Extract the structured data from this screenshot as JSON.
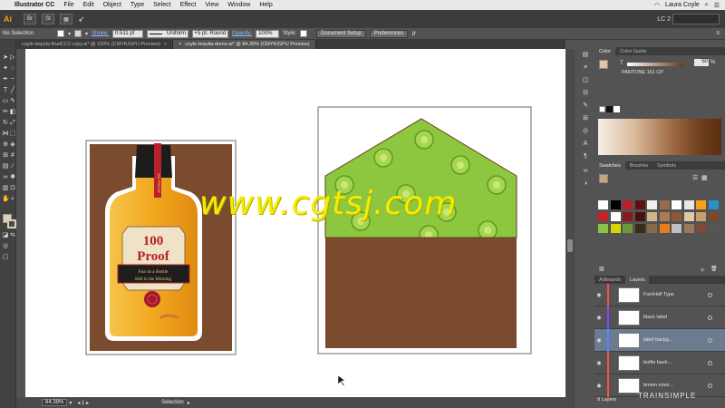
{
  "menubar": {
    "app_name": "Illustrator CC",
    "items": [
      "File",
      "Edit",
      "Object",
      "Type",
      "Select",
      "Effect",
      "View",
      "Window",
      "Help"
    ],
    "user": "Laura Coyle"
  },
  "appbar": {
    "logo": "Ai",
    "workspace": "LC 2"
  },
  "controlbar": {
    "selection_status": "No Selection",
    "stroke_label": "Stroke:",
    "stroke_weight": "0.511 pt",
    "profile": "Uniform",
    "brush": "5 pt. Round",
    "opacity_label": "Opacity:",
    "opacity_value": "100%",
    "style_label": "Style:",
    "document_setup": "Document Setup",
    "preferences": "Preferences"
  },
  "tabs": [
    {
      "label": "coyle-tequila-finalCC2 copy.ai* @ 150% (CMYK/GPU Preview)",
      "active": false
    },
    {
      "label": "coyle-tequila-demo.ai* @ 84.39% (CMYK/GPU Preview)",
      "active": true
    }
  ],
  "artwork": {
    "bottle_line1": "100",
    "bottle_line2": "Proof",
    "tagline1": "Fun in a Bottle",
    "tagline2": "Hell in the Morning",
    "ribbon_text": "100 PROOF"
  },
  "watermark": "www.cgtsj.com",
  "status": {
    "zoom": "84.39%",
    "tool": "Selection"
  },
  "color_panel": {
    "tabs": [
      "Color",
      "Color Guide"
    ],
    "slider_label": "T",
    "value": "50",
    "pct": "%",
    "spot_name": "PANTONE 161 CP"
  },
  "swatches_panel": {
    "tabs": [
      "Swatches",
      "Brushes",
      "Symbols"
    ],
    "colors": [
      "#ffffff",
      "#000000",
      "#bd1f2d",
      "#5e1010",
      "#f0f0f0",
      "#9a6b4a",
      "#ffffff",
      "#e8e8e8",
      "#f4a21a",
      "#2891c8",
      "#c82226",
      "#ffffff",
      "#8a1a1a",
      "#4a1010",
      "#d2b48c",
      "#b07a4a",
      "#8a5a3a",
      "#e3c8a8",
      "#c8a070",
      "#7a4a2a",
      "#8bc34a",
      "#d7d600",
      "#6a9a3a",
      "#3a2a1a",
      "#8a6a4a",
      "#e87d1e",
      "#bfbfbf",
      "#9a7a5a",
      "#7a4a3a",
      "#555555"
    ]
  },
  "layers_panel": {
    "tabs": [
      "Artboards",
      "Layers"
    ],
    "layers": [
      {
        "name": "Fun/Hell Type",
        "selected": false,
        "color": "#ff4d4d"
      },
      {
        "name": "black label",
        "selected": false,
        "color": "#7a4dff"
      },
      {
        "name": "label backg...",
        "selected": true,
        "color": "#4d8aff"
      },
      {
        "name": "bottle back...",
        "selected": false,
        "color": "#ff4d4d"
      },
      {
        "name": "brown enve...",
        "selected": false,
        "color": "#ff4d4d"
      }
    ],
    "count": "9 Layers",
    "brand": "TRAINSIMPLE"
  },
  "colors": {
    "envelope_brown": "#7a4b2e",
    "lime_green": "#8dc63f",
    "bottle_orange": "#f2a81e",
    "selection_blue": "#6d7b90"
  }
}
